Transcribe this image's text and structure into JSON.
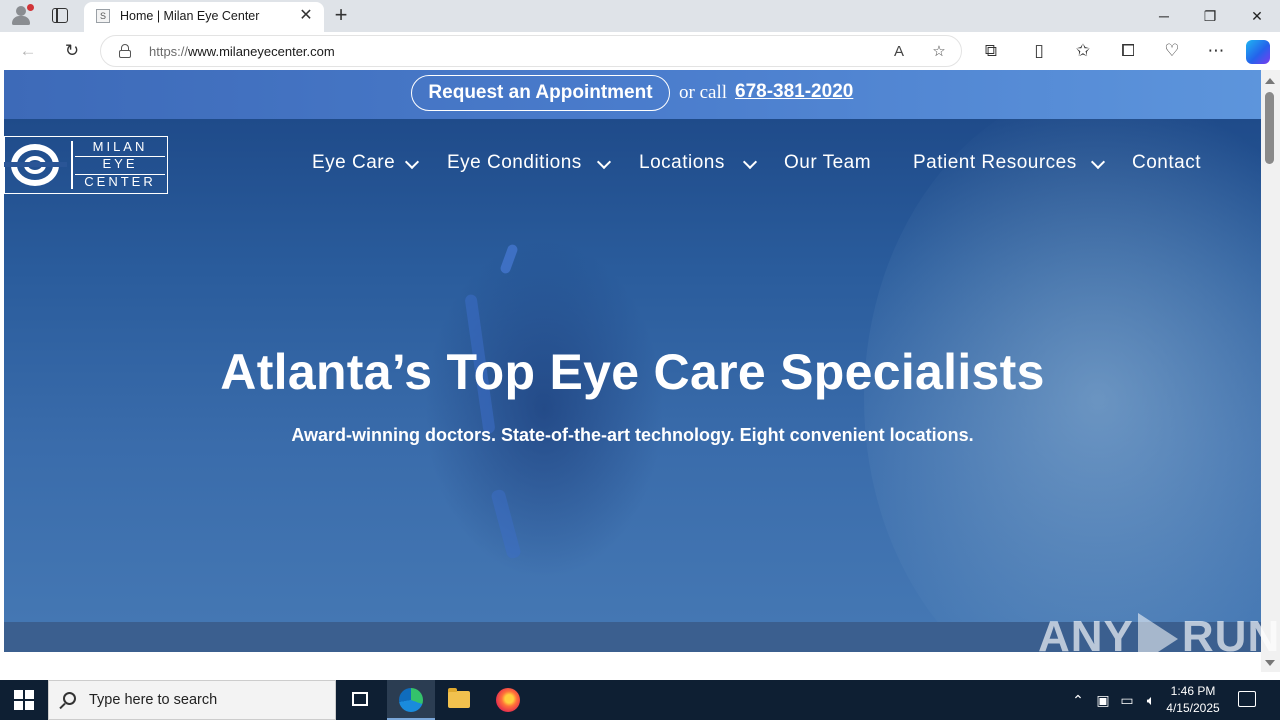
{
  "browser": {
    "tab_title": "Home | Milan Eye Center",
    "tab_favicon": "S",
    "url_protocol": "https://",
    "url_host": "www.milaneyecenter.com"
  },
  "page": {
    "topbar": {
      "appointment_label": "Request an Appointment",
      "or_call": "or call",
      "phone": "678-381-2020"
    },
    "logo": {
      "line1": "MILAN",
      "line2": "EYE",
      "line3": "CENTER"
    },
    "nav": [
      {
        "label": "Eye Care",
        "dropdown": true
      },
      {
        "label": "Eye Conditions",
        "dropdown": true
      },
      {
        "label": "Locations",
        "dropdown": true
      },
      {
        "label": "Our Team",
        "dropdown": false
      },
      {
        "label": "Patient Resources",
        "dropdown": true
      },
      {
        "label": "Contact",
        "dropdown": false
      }
    ],
    "hero": {
      "title": "Atlanta’s Top Eye Care Specialists",
      "subtitle": "Award-winning doctors. State-of-the-art technology. Eight convenient locations."
    }
  },
  "watermark": {
    "left": "ANY",
    "right": "RUN"
  },
  "taskbar": {
    "search_placeholder": "Type here to search",
    "time": "1:46 PM",
    "date": "4/15/2025"
  },
  "colors": {
    "topbar": "#4a7ccc",
    "hero": "#2a5c9c",
    "taskbar": "#0e1f33"
  }
}
